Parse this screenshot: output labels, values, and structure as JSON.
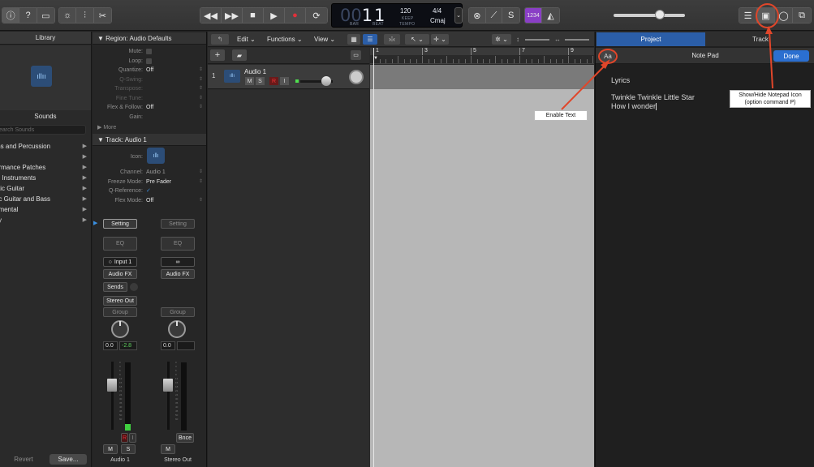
{
  "control_bar": {
    "lcd": {
      "bar_dim": "00",
      "bar": "1",
      "beat": "1",
      "bar_label": "BAR",
      "beat_label": "BEAT",
      "tempo": "120",
      "keep_label": "KEEP",
      "tempo_label": "TEMPO",
      "time_sig": "4/4",
      "key": "Cmaj"
    },
    "count_in": "1234",
    "slider_fraction": 0.65,
    "icons": {
      "library": "info-icon",
      "help": "help-icon",
      "toolbar": "toolbar-icon",
      "smart_controls": "smart-controls-icon",
      "mixer": "mixer-icon",
      "editors": "scissors-icon",
      "rewind": "rewind-icon",
      "forward": "fast-forward-icon",
      "stop": "stop-icon",
      "play": "play-icon",
      "record": "record-icon",
      "cycle": "cycle-icon",
      "replace": "replace-icon",
      "tuning": "tuning-fork-icon",
      "solo": "solo-icon",
      "metronome": "metronome-icon",
      "list_editors": "list-editors-icon",
      "notepad": "notepad-icon",
      "loops": "loop-browser-icon",
      "browsers": "browsers-icon"
    }
  },
  "library": {
    "title": "Library",
    "sounds_label": "Sounds",
    "search_placeholder": "earch Sounds",
    "items": [
      "ms and Percussion",
      "e",
      "ormance Patches",
      "io Instruments",
      "stic Guitar",
      "ric Guitar and Bass",
      "rimental",
      "cy"
    ],
    "revert": "Revert",
    "save": "Save..."
  },
  "inspector": {
    "region_header": "▼ Region:",
    "region_name": "Audio Defaults",
    "region_props": [
      {
        "k": "Mute:",
        "v": "",
        "type": "check",
        "dim": false
      },
      {
        "k": "Loop:",
        "v": "",
        "type": "check",
        "dim": false
      },
      {
        "k": "Quantize:",
        "v": "Off",
        "type": "value",
        "dim": false
      },
      {
        "k": "Q-Swing:",
        "v": "",
        "type": "value",
        "dim": true
      },
      {
        "k": "Transpose:",
        "v": "",
        "type": "value",
        "dim": true
      },
      {
        "k": "Fine Tune:",
        "v": "",
        "type": "value",
        "dim": true
      },
      {
        "k": "Flex & Follow:",
        "v": "Off",
        "type": "value",
        "dim": false
      },
      {
        "k": "Gain:",
        "v": "",
        "type": "value",
        "dim": false
      }
    ],
    "more": "▶ More",
    "track_header": "▼ Track:",
    "track_name": "Audio 1",
    "icon_label": "Icon:",
    "track_props": [
      {
        "k": "Channel:",
        "v": "Audio 1"
      },
      {
        "k": "Freeze Mode:",
        "v": "Pre Fader"
      },
      {
        "k": "Q-Reference:",
        "v": "✓"
      },
      {
        "k": "Flex Mode:",
        "v": "Off"
      }
    ],
    "strip1": {
      "setting": "Setting",
      "eq": "EQ",
      "input": "Input 1",
      "audio_fx": "Audio FX",
      "sends": "Sends",
      "output": "Stereo Out",
      "group": "Group",
      "vol": "0.0",
      "peak": "-2.8",
      "r": "R",
      "i": "I",
      "m": "M",
      "s": "S",
      "name": "Audio 1"
    },
    "strip2": {
      "setting": "Setting",
      "eq": "EQ",
      "link": "∞",
      "audio_fx": "Audio FX",
      "group": "Group",
      "vol": "0.0",
      "m": "M",
      "bnce": "Bnce",
      "name": "Stereo Out"
    },
    "meter_ticks": [
      "0",
      "3",
      "6",
      "9",
      "12",
      "15",
      "18",
      "21",
      "24",
      "30",
      "35",
      "40",
      "45",
      "50",
      "60"
    ]
  },
  "tracks": {
    "toolbar": {
      "edit": "Edit",
      "functions": "Functions",
      "view": "View"
    },
    "ruler": [
      "1",
      "3",
      "5",
      "7",
      "9"
    ],
    "track": {
      "number": "1",
      "name": "Audio 1",
      "m": "M",
      "s": "S",
      "r": "R",
      "i": "I",
      "volume_fraction": 0.8
    }
  },
  "notepad": {
    "tab_project": "Project",
    "tab_track": "Track",
    "text_button": "Aa",
    "title": "Note Pad",
    "done": "Done",
    "lines": [
      "Lyrics",
      "Twinkle Twinkle Little Star",
      "How I wonder"
    ]
  },
  "annotations": {
    "enable_text": "Enable Text",
    "notepad_line1": "Show/Hide Notepad Icon",
    "notepad_line2": "(option command P)",
    "color": "#e0462a"
  }
}
